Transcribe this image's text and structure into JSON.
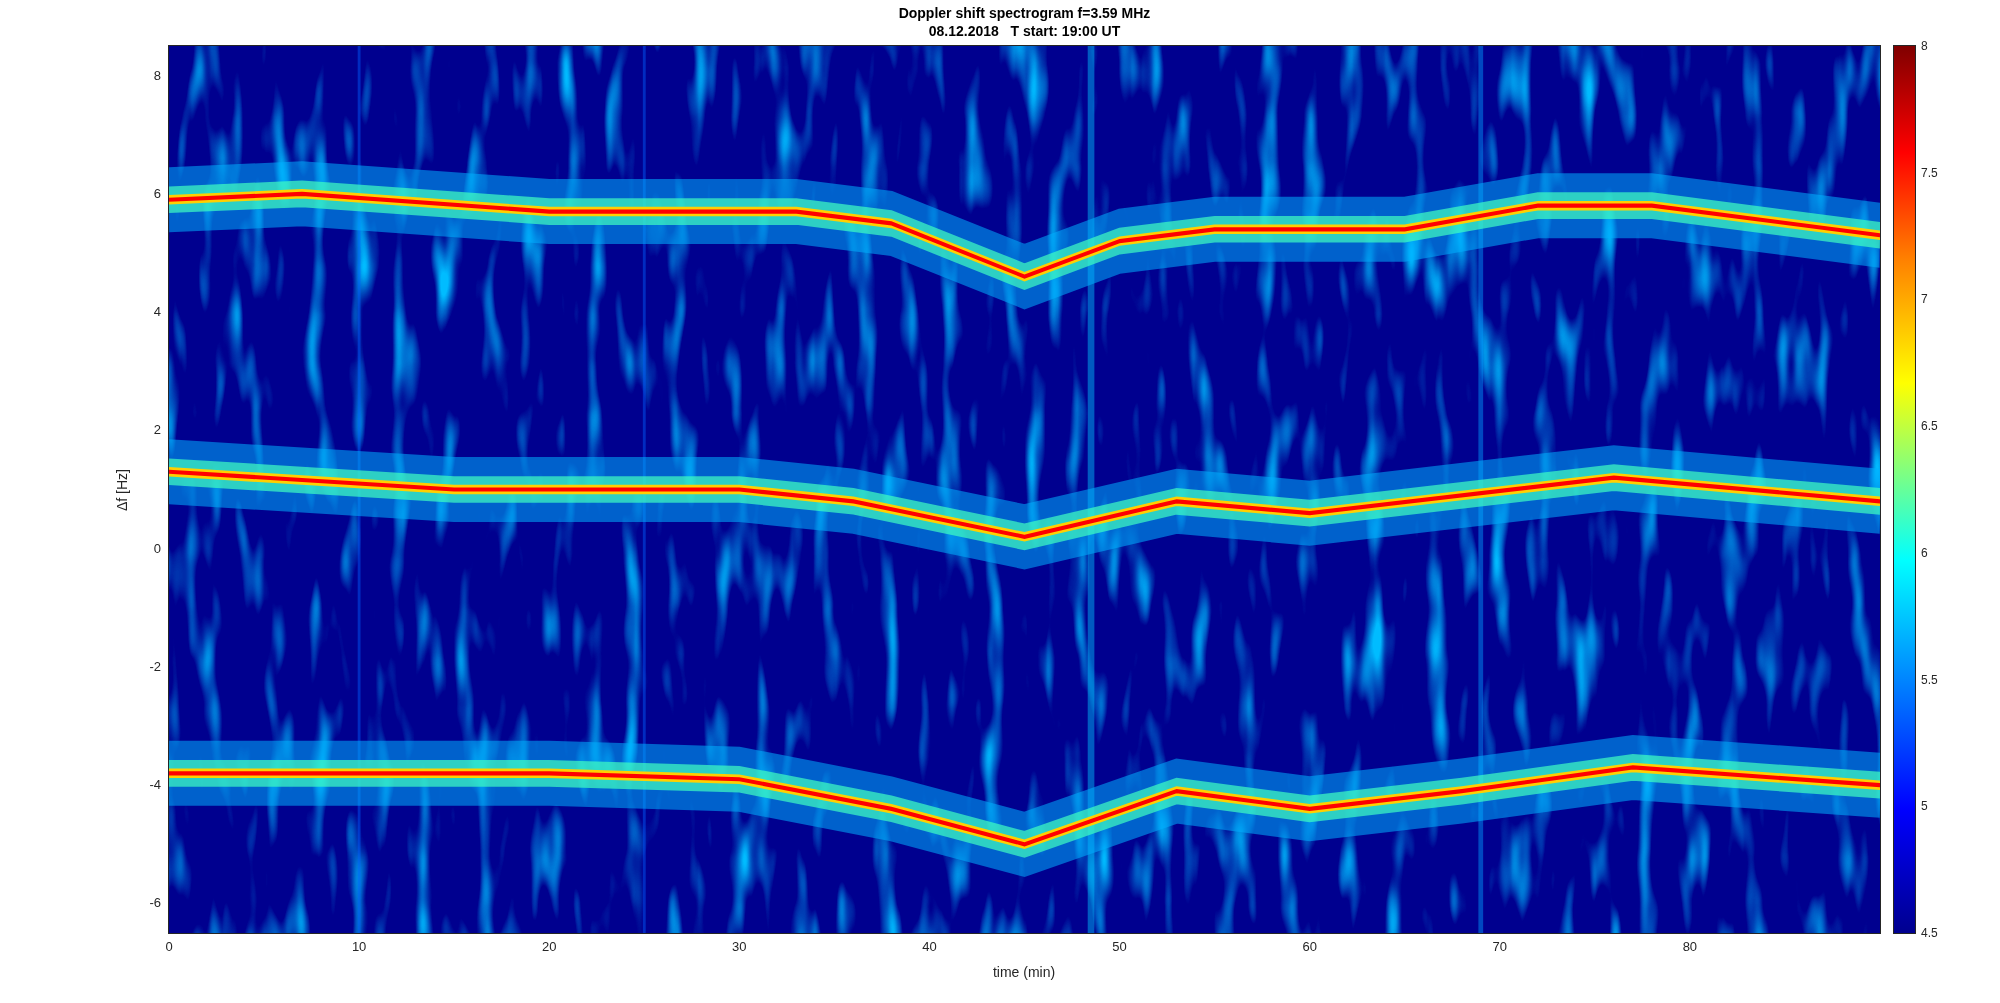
{
  "title": "Doppler shift spectrogram f=3.59 MHz",
  "subtitle": "08.12.2018   T start: 19:00 UT",
  "xlabel": "time (min)",
  "ylabel": "Δf [Hz]",
  "xticks": [
    "0",
    "10",
    "20",
    "30",
    "40",
    "50",
    "60",
    "70",
    "80"
  ],
  "yticks": [
    "8",
    "6",
    "4",
    "2",
    "0",
    "-2",
    "-4",
    "-6"
  ],
  "colorbar_ticks": [
    "8",
    "7.5",
    "7",
    "6.5",
    "6",
    "5.5",
    "5",
    "4.5"
  ]
}
